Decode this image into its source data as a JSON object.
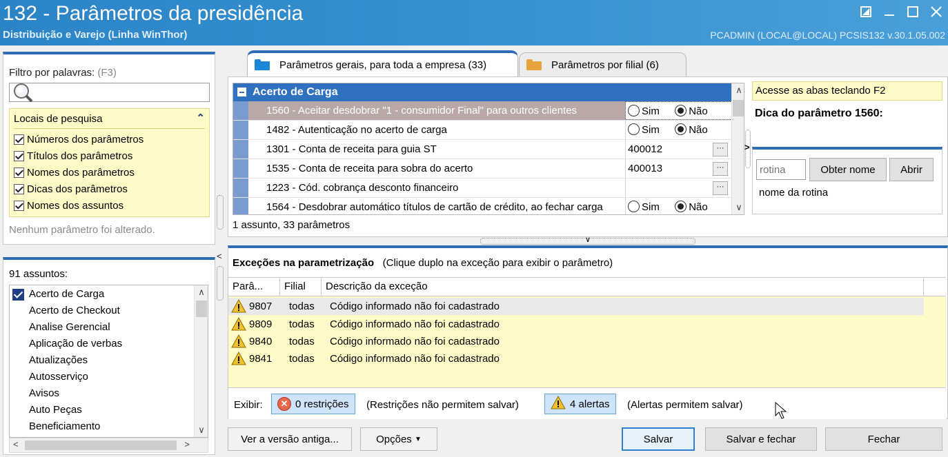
{
  "window": {
    "title": "132 - Parâmetros da presidência",
    "subtitle": "Distribuição e Varejo (Linha WinThor)",
    "userinfo": "PCADMIN (LOCAL@LOCAL)  PCSIS132  v.30.1.05.002"
  },
  "filter": {
    "label": "Filtro por palavras:",
    "shortcut": "(F3)",
    "search_value": "",
    "locais_title": "Locais de pesquisa",
    "locais": [
      "Números dos parâmetros",
      "Títulos dos parâmetros",
      "Nomes dos parâmetros",
      "Dicas dos parâmetros",
      "Nomes dos assuntos"
    ],
    "status": "Nenhum parâmetro foi alterado."
  },
  "assuntos": {
    "count_label": "91 assuntos:",
    "items": [
      "Acerto de Carga",
      "Acerto de Checkout",
      "Analise Gerencial",
      "Aplicação de verbas",
      "Atualizações",
      "Autosserviço",
      "Avisos",
      "Auto Peças",
      "Beneficiamento"
    ]
  },
  "tabs": {
    "geral": "Parâmetros gerais, para toda a empresa  (33)",
    "filial": "Parâmetros por filial  (6)"
  },
  "params": {
    "group": "Acerto de Carga",
    "rows": [
      {
        "desc": "1560 - Aceitar desdobrar \"1 - consumidor Final\" para outros clientes",
        "type": "radio",
        "sim": "Sim",
        "nao": "Não"
      },
      {
        "desc": "1482 - Autenticação no acerto de carga",
        "type": "radio",
        "sim": "Sim",
        "nao": "Não"
      },
      {
        "desc": "1301 - Conta de receita para guia ST",
        "type": "text",
        "value": "400012"
      },
      {
        "desc": "1535 - Conta de receita para sobra do acerto",
        "type": "text",
        "value": "400013"
      },
      {
        "desc": "1223 - Cód. cobrança desconto financeiro",
        "type": "text",
        "value": ""
      },
      {
        "desc": "1564 - Desdobrar automático títulos de cartão de crédito, ao fechar carga",
        "type": "radio",
        "sim": "Sim",
        "nao": "Não"
      }
    ],
    "footer": "1 assunto, 33 parâmetros"
  },
  "side": {
    "hint": "Acesse as abas teclando F2",
    "dica": "Dica do parâmetro 1560:",
    "rotina_placeholder": "rotina",
    "obter_nome": "Obter nome",
    "abrir": "Abrir",
    "nome_rotina": "nome da rotina"
  },
  "excecoes": {
    "title": "Exceções na parametrização",
    "subtitle": "(Clique duplo na exceção para exibir o parâmetro)",
    "headers": [
      "Parâ...",
      "Filial",
      "Descrição da exceção"
    ],
    "rows": [
      {
        "param": "9807",
        "filial": "todas",
        "desc": "Código informado não foi cadastrado"
      },
      {
        "param": "9809",
        "filial": "todas",
        "desc": "Código informado não foi cadastrado"
      },
      {
        "param": "9840",
        "filial": "todas",
        "desc": "Código informado não foi cadastrado"
      },
      {
        "param": "9841",
        "filial": "todas",
        "desc": "Código informado não foi cadastrado"
      }
    ],
    "exibir": "Exibir:",
    "restricoes": "0 restrições",
    "restricoes_note": "(Restrições não permitem salvar)",
    "alertas": "4 alertas",
    "alertas_note": "(Alertas permitem salvar)"
  },
  "buttons": {
    "versao": "Ver a versão antiga...",
    "opcoes": "Opções",
    "salvar": "Salvar",
    "salvar_fechar": "Salvar e fechar",
    "fechar": "Fechar"
  }
}
